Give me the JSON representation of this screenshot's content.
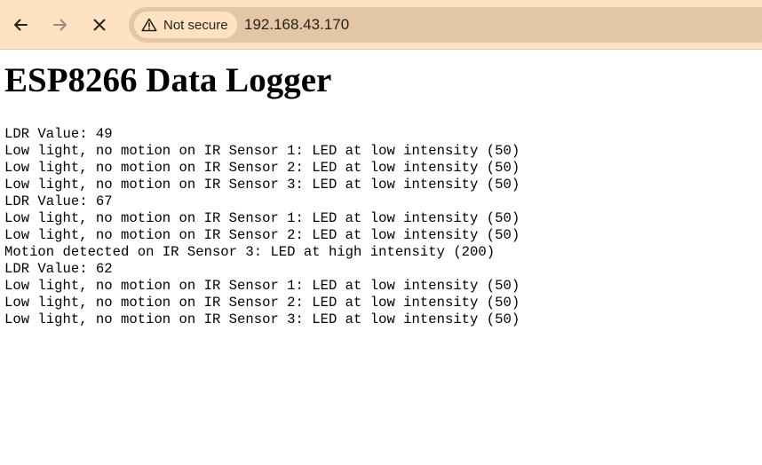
{
  "browser": {
    "security_label": "Not secure",
    "url": "192.168.43.170",
    "icons": {
      "back": "back-arrow-icon",
      "forward": "forward-arrow-icon",
      "stop": "close-icon",
      "security": "warning-triangle-icon"
    },
    "colors": {
      "toolbar": "#ffe2c2",
      "omnibox": "#e2c6a5"
    }
  },
  "page": {
    "title": "ESP8266 Data Logger",
    "log_lines": [
      "LDR Value: 49",
      "Low light, no motion on IR Sensor 1: LED at low intensity (50)",
      "Low light, no motion on IR Sensor 2: LED at low intensity (50)",
      "Low light, no motion on IR Sensor 3: LED at low intensity (50)",
      "LDR Value: 67",
      "Low light, no motion on IR Sensor 1: LED at low intensity (50)",
      "Low light, no motion on IR Sensor 2: LED at low intensity (50)",
      "Motion detected on IR Sensor 3: LED at high intensity (200)",
      "LDR Value: 62",
      "Low light, no motion on IR Sensor 1: LED at low intensity (50)",
      "Low light, no motion on IR Sensor 2: LED at low intensity (50)",
      "Low light, no motion on IR Sensor 3: LED at low intensity (50)"
    ]
  }
}
